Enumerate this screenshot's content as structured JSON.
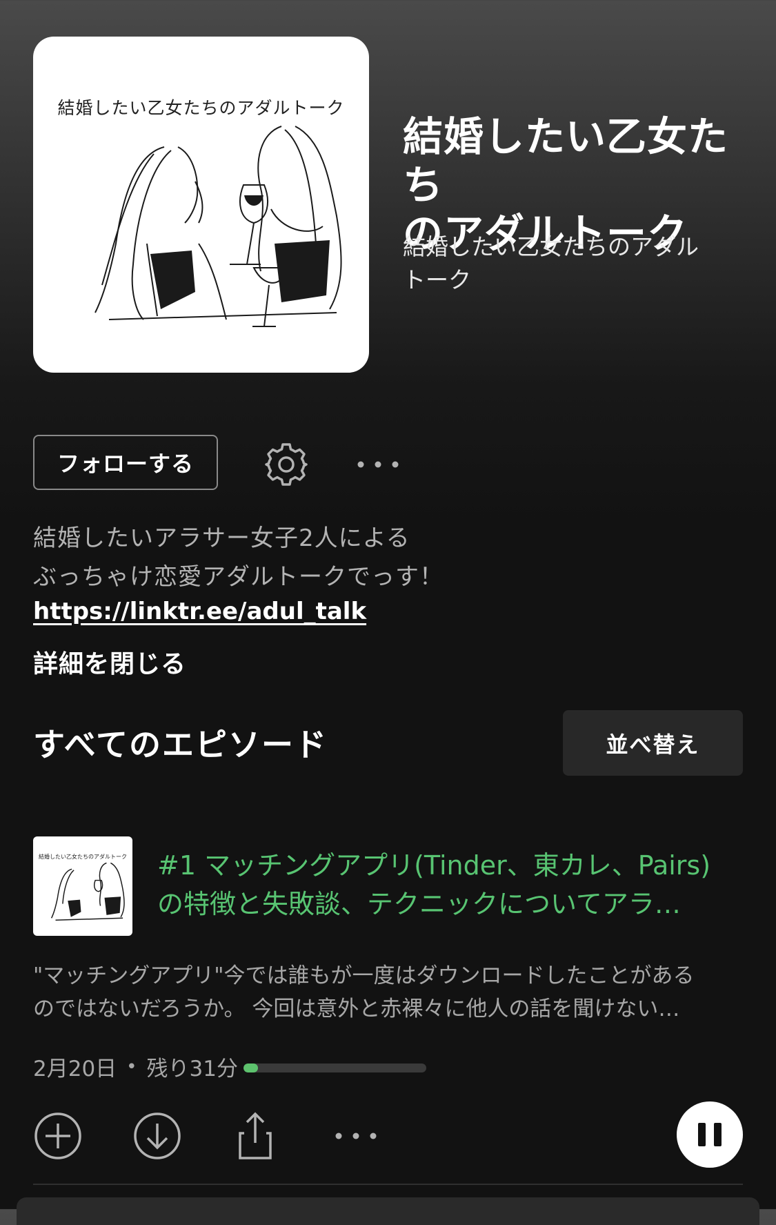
{
  "show": {
    "cover_caption": "結婚したい乙女たちのアダルトーク",
    "title_line1": "結婚したい乙女たち",
    "title_line2": "のアダルトーク",
    "author_line1": "結婚したい乙女たちのアダル",
    "author_line2": "トーク"
  },
  "actions": {
    "follow_label": "フォローする",
    "settings_icon": "gear-icon",
    "more_icon": "more-horizontal-icon"
  },
  "description": {
    "line1": "結婚したいアラサー女子2人による",
    "line2": "ぶっちゃけ恋愛アダルトークでっす！",
    "link": "https://linktr.ee/adul_talk",
    "close_label": "詳細を閉じる"
  },
  "episodes_section": {
    "title": "すべてのエピソード",
    "sort_label": "並べ替え"
  },
  "episode": {
    "thumb_caption": "結婚したい乙女たちのアダルトーク",
    "title_line1": "#1 マッチングアプリ(Tinder、東カレ、Pairs)",
    "title_line2": "の特徴と失敗談、テクニックについてアラ…",
    "desc_line1": "\"マッチングアプリ\"今では誰もが一度はダウンロードしたことがある",
    "desc_line2": "のではないだろうか。 今回は意外と赤裸々に他人の話を聞けない…",
    "date": "2月20日",
    "separator": "•",
    "remaining": "残り31分",
    "progress_fraction": 0.08,
    "accent_color": "#5dc26d",
    "icons": [
      "add-icon",
      "download-icon",
      "share-icon",
      "more-horizontal-icon",
      "pause-icon"
    ]
  }
}
